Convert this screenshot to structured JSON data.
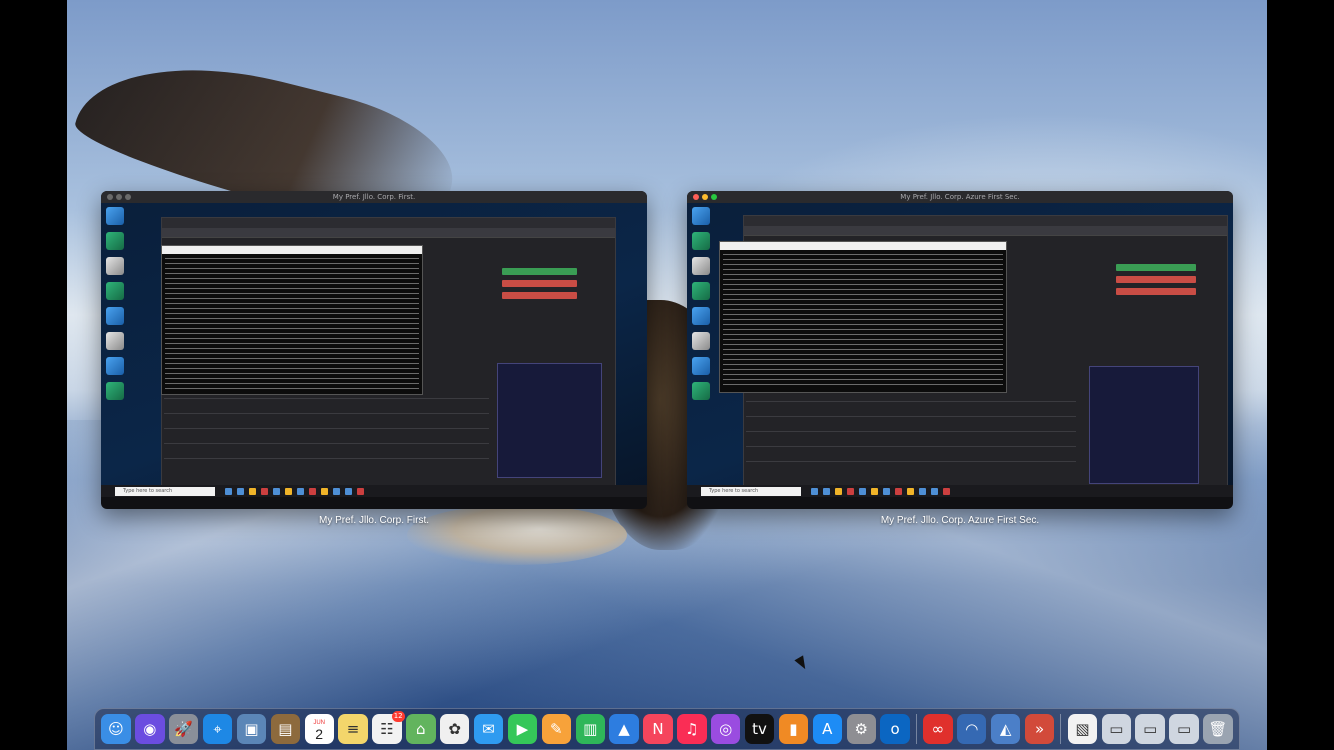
{
  "windows": [
    {
      "title": "My Pref. Jllo. Corp. First.",
      "label": "My Pref. Jllo. Corp. First.",
      "taskbar_search_placeholder": "Type here to search"
    },
    {
      "title": "My Pref. Jllo. Corp. Azure First Sec.",
      "label": "My Pref. Jllo. Corp. Azure First Sec.",
      "taskbar_search_placeholder": "Type here to search"
    }
  ],
  "dock": {
    "items": [
      {
        "name": "finder",
        "glyph": "☺",
        "color": "#3a8ee6"
      },
      {
        "name": "siri",
        "glyph": "◉",
        "color": "#6b4de0"
      },
      {
        "name": "launchpad",
        "glyph": "🚀",
        "color": "#8a8f99"
      },
      {
        "name": "safari",
        "glyph": "⌖",
        "color": "#1e88e5"
      },
      {
        "name": "preview",
        "glyph": "▣",
        "color": "#5b86b7"
      },
      {
        "name": "notebook",
        "glyph": "▤",
        "color": "#8d6a3d"
      },
      {
        "name": "calendar",
        "glyph": "",
        "color": "#ffffff"
      },
      {
        "name": "notes",
        "glyph": "≡",
        "color": "#f3d66b"
      },
      {
        "name": "reminders",
        "glyph": "☷",
        "color": "#f2f2f2"
      },
      {
        "name": "maps",
        "glyph": "⌂",
        "color": "#62b45e"
      },
      {
        "name": "photos",
        "glyph": "✿",
        "color": "#f0f0f0"
      },
      {
        "name": "messages",
        "glyph": "✉",
        "color": "#2f9bf0"
      },
      {
        "name": "facetime",
        "glyph": "▶",
        "color": "#35c759"
      },
      {
        "name": "pages",
        "glyph": "✎",
        "color": "#f7a23a"
      },
      {
        "name": "numbers",
        "glyph": "▥",
        "color": "#2fb659"
      },
      {
        "name": "keynote",
        "glyph": "▲",
        "color": "#2d7de0"
      },
      {
        "name": "news",
        "glyph": "N",
        "color": "#f5455c"
      },
      {
        "name": "music",
        "glyph": "♫",
        "color": "#fa2d55"
      },
      {
        "name": "podcasts",
        "glyph": "◎",
        "color": "#9a4ce0"
      },
      {
        "name": "apple-tv",
        "glyph": "tv",
        "color": "#111111"
      },
      {
        "name": "books",
        "glyph": "▮",
        "color": "#f08a24"
      },
      {
        "name": "app-store",
        "glyph": "A",
        "color": "#1d8cf5"
      },
      {
        "name": "system-preferences",
        "glyph": "⚙",
        "color": "#8e8e93"
      },
      {
        "name": "outlook",
        "glyph": "o",
        "color": "#0b66c2"
      },
      {
        "name": "sep",
        "glyph": "",
        "color": ""
      },
      {
        "name": "creative-cloud",
        "glyph": "∞",
        "color": "#e0302c"
      },
      {
        "name": "wifi-explorer",
        "glyph": "◠",
        "color": "#3569b3"
      },
      {
        "name": "network-radar",
        "glyph": "◭",
        "color": "#4b7fc8"
      },
      {
        "name": "remote-desktop",
        "glyph": "»",
        "color": "#d24a3a"
      },
      {
        "name": "sep",
        "glyph": "",
        "color": ""
      },
      {
        "name": "document",
        "glyph": "▧",
        "color": "#f2f2f2"
      },
      {
        "name": "window-thumb-1",
        "glyph": "▭",
        "color": "#cfd6e0"
      },
      {
        "name": "window-thumb-2",
        "glyph": "▭",
        "color": "#cfd6e0"
      },
      {
        "name": "window-thumb-3",
        "glyph": "▭",
        "color": "#cfd6e0"
      },
      {
        "name": "trash",
        "glyph": "🗑",
        "color": "#9aa4b1"
      }
    ],
    "calendar_month": "JUN",
    "calendar_day": "2",
    "reminders_badge": "12"
  }
}
